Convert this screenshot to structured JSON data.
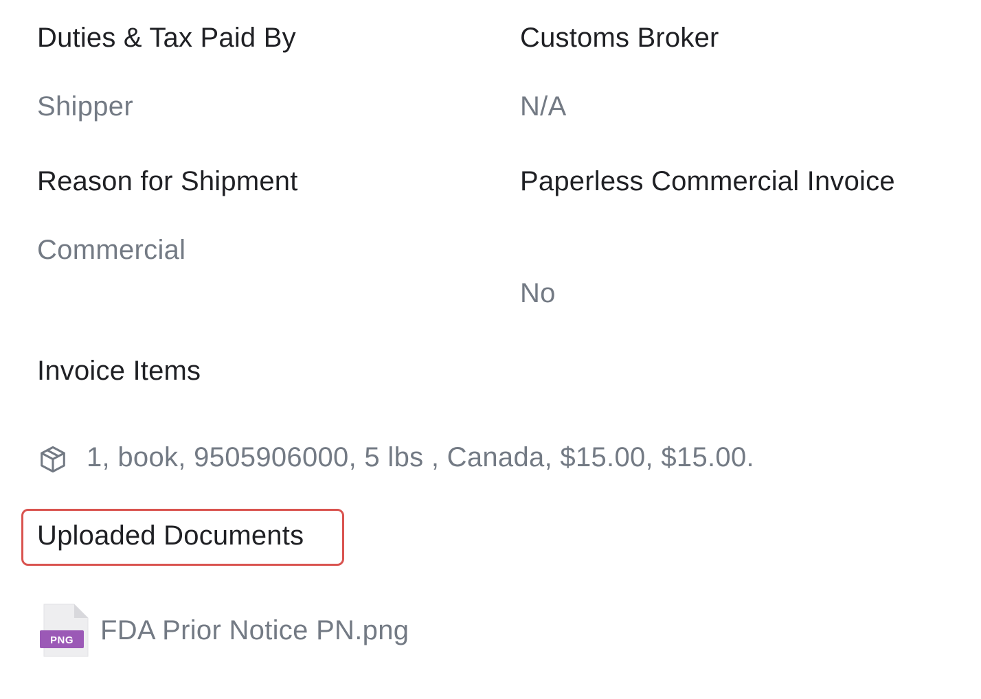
{
  "customs": {
    "duties_label": "Duties & Tax Paid By",
    "duties_value": "Shipper",
    "broker_label": "Customs Broker",
    "broker_value": "N/A",
    "reason_label": "Reason for Shipment",
    "reason_value": "Commercial",
    "paperless_label": "Paperless Commercial Invoice",
    "paperless_value": "No"
  },
  "invoice": {
    "title": "Invoice Items",
    "items": [
      {
        "icon": "box-icon",
        "text": "1, book, 9505906000, 5 lbs , Canada, $15.00, $15.00."
      }
    ]
  },
  "documents": {
    "title": "Uploaded Documents",
    "highlight_color": "#d9534f",
    "files": [
      {
        "icon": "png-file-icon",
        "badge": "PNG",
        "name": "FDA Prior Notice PN.png"
      }
    ]
  },
  "colors": {
    "label": "#1f2024",
    "value": "#737a84",
    "png_badge": "#9b59b6"
  }
}
